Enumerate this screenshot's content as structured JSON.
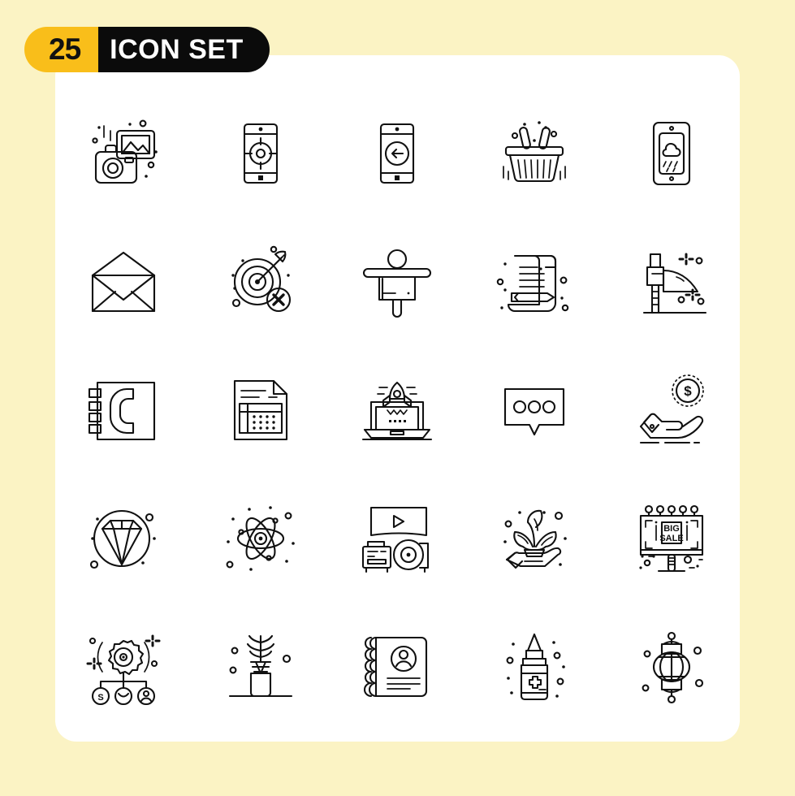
{
  "page": {
    "background_color": "#FBF3C4",
    "card_color": "#FFFFFF",
    "icon_stroke_color": "#111111"
  },
  "badge": {
    "count": "25",
    "title": "ICON SET",
    "count_bg": "#F9BE1A",
    "title_bg": "#0B0B0B",
    "title_color": "#FFFFFF",
    "count_color": "#111111"
  },
  "grid": {
    "columns": 5,
    "rows": 5,
    "total_icons": 25
  },
  "icons": [
    {
      "index": 1,
      "name": "camera-photo-icon",
      "label": "Camera with photo"
    },
    {
      "index": 2,
      "name": "mobile-target-icon",
      "label": "Mobile target"
    },
    {
      "index": 3,
      "name": "mobile-back-arrow-icon",
      "label": "Mobile back"
    },
    {
      "index": 4,
      "name": "shopping-basket-icon",
      "label": "Shopping basket"
    },
    {
      "index": 5,
      "name": "mobile-weather-icon",
      "label": "Mobile weather"
    },
    {
      "index": 6,
      "name": "open-envelope-icon",
      "label": "Open envelope"
    },
    {
      "index": 7,
      "name": "target-miss-icon",
      "label": "Target with cross"
    },
    {
      "index": 8,
      "name": "scarecrow-icon",
      "label": "Scarecrow"
    },
    {
      "index": 9,
      "name": "scroll-pencil-icon",
      "label": "Scroll with pencil"
    },
    {
      "index": 10,
      "name": "flag-pole-icon",
      "label": "Flag pole"
    },
    {
      "index": 11,
      "name": "phone-book-icon",
      "label": "Phone book"
    },
    {
      "index": 12,
      "name": "spreadsheet-icon",
      "label": "Spreadsheet document"
    },
    {
      "index": 13,
      "name": "laptop-rocket-icon",
      "label": "Laptop startup"
    },
    {
      "index": 14,
      "name": "chat-bubble-icon",
      "label": "Chat bubble"
    },
    {
      "index": 15,
      "name": "hand-dollar-coin-icon",
      "label": "Hand with dollar coin"
    },
    {
      "index": 16,
      "name": "diamond-icon",
      "label": "Diamond"
    },
    {
      "index": 17,
      "name": "atom-icon",
      "label": "Atom"
    },
    {
      "index": 18,
      "name": "projector-screen-icon",
      "label": "Projector with screen"
    },
    {
      "index": 19,
      "name": "hand-plant-icon",
      "label": "Hand with plant"
    },
    {
      "index": 20,
      "name": "billboard-big-sale-icon",
      "label": "Billboard big sale"
    },
    {
      "index": 21,
      "name": "gear-network-icon",
      "label": "Gear network"
    },
    {
      "index": 22,
      "name": "plant-vase-icon",
      "label": "Plant in vase"
    },
    {
      "index": 23,
      "name": "contact-notebook-icon",
      "label": "Contact notebook"
    },
    {
      "index": 24,
      "name": "medicine-bottle-icon",
      "label": "Medicine bottle"
    },
    {
      "index": 25,
      "name": "lantern-icon",
      "label": "Lantern"
    }
  ],
  "icon_text": {
    "billboard_line1": "BIG",
    "billboard_line2": "SALE",
    "coin_symbol": "$",
    "node_symbol": "S"
  }
}
